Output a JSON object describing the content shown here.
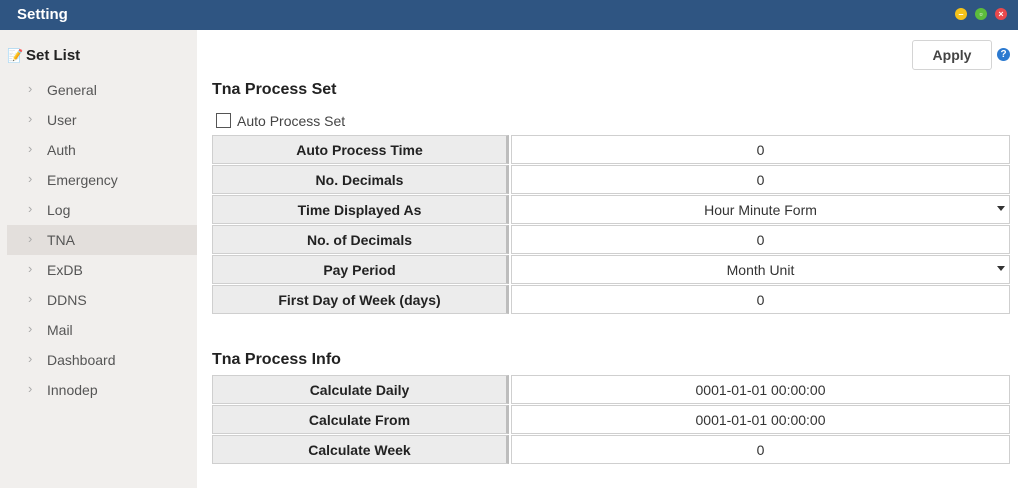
{
  "window": {
    "title": "Setting"
  },
  "sidebar": {
    "heading": "Set List",
    "items": [
      {
        "label": "General"
      },
      {
        "label": "User"
      },
      {
        "label": "Auth"
      },
      {
        "label": "Emergency"
      },
      {
        "label": "Log"
      },
      {
        "label": "TNA",
        "active": true
      },
      {
        "label": "ExDB"
      },
      {
        "label": "DDNS"
      },
      {
        "label": "Mail"
      },
      {
        "label": "Dashboard"
      },
      {
        "label": "Innodep"
      }
    ]
  },
  "toolbar": {
    "apply_label": "Apply",
    "help_glyph": "?"
  },
  "process_set": {
    "title": "Tna Process Set",
    "auto_process": {
      "label": "Auto Process Set",
      "checked": false
    },
    "rows": [
      {
        "label": "Auto Process Time",
        "value": "0",
        "type": "number"
      },
      {
        "label": "No. Decimals",
        "value": "0",
        "type": "number"
      },
      {
        "label": "Time Displayed As",
        "value": "Hour Minute Form",
        "type": "select"
      },
      {
        "label": "No. of Decimals",
        "value": "0",
        "type": "number"
      },
      {
        "label": "Pay Period",
        "value": "Month Unit",
        "type": "select"
      },
      {
        "label": "First Day of Week (days)",
        "value": "0",
        "type": "number"
      }
    ]
  },
  "process_info": {
    "title": "Tna Process Info",
    "rows": [
      {
        "label": "Calculate Daily",
        "value": "0001-01-01 00:00:00"
      },
      {
        "label": "Calculate From",
        "value": "0001-01-01 00:00:00"
      },
      {
        "label": "Calculate Week",
        "value": "0"
      }
    ]
  }
}
